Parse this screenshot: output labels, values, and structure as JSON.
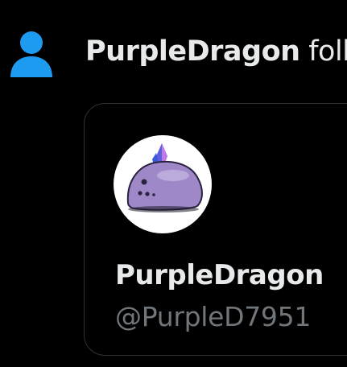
{
  "notification": {
    "icon": "person-icon",
    "actor_name": "PurpleDragon",
    "action_text": " foll",
    "icon_color": "#1d9bf0"
  },
  "user_card": {
    "avatar": "purple-blob-avatar",
    "display_name": "PurpleDragon",
    "handle": "@PurpleD7951"
  },
  "colors": {
    "background": "#000000",
    "primary_text": "#e7e9ea",
    "secondary_text": "#71767b",
    "border": "#2f3336",
    "accent": "#1d9bf0"
  }
}
